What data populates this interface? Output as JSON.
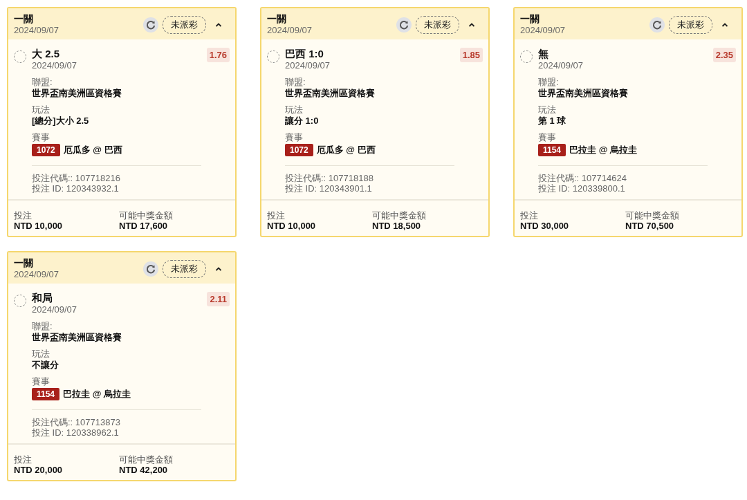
{
  "bets": [
    {
      "type": "一關",
      "date": "2024/09/07",
      "status": "未派彩",
      "expanded": true,
      "pick": "大 2.5",
      "pick_date": "2024/09/07",
      "odds": "1.76",
      "league_label": "聯盟:",
      "league": "世界盃南美洲區資格賽",
      "market_label": "玩法",
      "market": "[總分]大小 2.5",
      "event_label": "賽事",
      "event_code": "1072",
      "event": "厄瓜多 @ 巴西",
      "bet_code": "投注代碼:: 107718216",
      "bet_id": "投注 ID: 120343932.1",
      "stake_label": "投注",
      "stake": "NTD 10,000",
      "payout_label": "可能中獎金額",
      "payout": "NTD 17,600"
    },
    {
      "type": "一關",
      "date": "2024/09/07",
      "status": "未派彩",
      "expanded": true,
      "pick": "巴西 1:0",
      "pick_date": "2024/09/07",
      "odds": "1.85",
      "league_label": "聯盟:",
      "league": "世界盃南美洲區資格賽",
      "market_label": "玩法",
      "market": "讓分 1:0",
      "event_label": "賽事",
      "event_code": "1072",
      "event": "厄瓜多 @ 巴西",
      "bet_code": "投注代碼:: 107718188",
      "bet_id": "投注 ID: 120343901.1",
      "stake_label": "投注",
      "stake": "NTD 10,000",
      "payout_label": "可能中獎金額",
      "payout": "NTD 18,500"
    },
    {
      "type": "一關",
      "date": "2024/09/07",
      "status": "未派彩",
      "expanded": true,
      "pick": "無",
      "pick_date": "2024/09/07",
      "odds": "2.35",
      "league_label": "聯盟:",
      "league": "世界盃南美洲區資格賽",
      "market_label": "玩法",
      "market": "第 1 球",
      "event_label": "賽事",
      "event_code": "1154",
      "event": "巴拉圭 @ 烏拉圭",
      "bet_code": "投注代碼:: 107714624",
      "bet_id": "投注 ID: 120339800.1",
      "stake_label": "投注",
      "stake": "NTD 30,000",
      "payout_label": "可能中獎金額",
      "payout": "NTD 70,500"
    },
    {
      "type": "一關",
      "date": "2024/09/07",
      "status": "未派彩",
      "expanded": true,
      "pick": "和局",
      "pick_date": "2024/09/07",
      "odds": "2.11",
      "league_label": "聯盟:",
      "league": "世界盃南美洲區資格賽",
      "market_label": "玩法",
      "market": "不讓分",
      "event_label": "賽事",
      "event_code": "1154",
      "event": "巴拉圭 @ 烏拉圭",
      "bet_code": "投注代碼:: 107713873",
      "bet_id": "投注 ID: 120338962.1",
      "stake_label": "投注",
      "stake": "NTD 20,000",
      "payout_label": "可能中獎金額",
      "payout": "NTD 42,200"
    }
  ]
}
